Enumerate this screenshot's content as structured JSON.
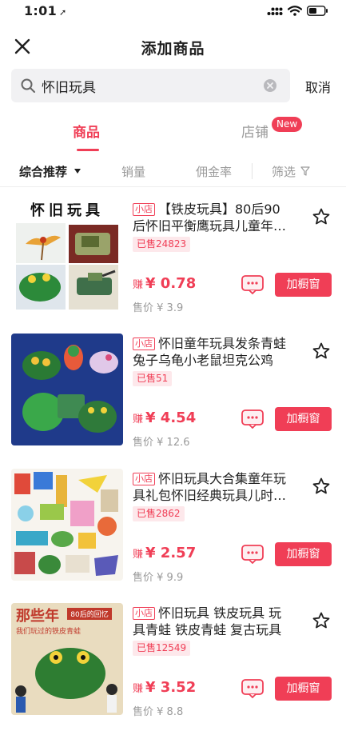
{
  "status": {
    "time": "1:01",
    "location_glyph": "➚"
  },
  "nav": {
    "title": "添加商品"
  },
  "search": {
    "query": "怀旧玩具",
    "cancel_label": "取消"
  },
  "tabs": {
    "goods": "商品",
    "shop": "店铺",
    "shop_badge": "New"
  },
  "filters": {
    "sort": "综合推荐",
    "sales": "销量",
    "commission": "佣金率",
    "screen": "筛选"
  },
  "common": {
    "store_tag": "小店",
    "earn_label": "赚",
    "price_label": "售价",
    "add_label": "加橱窗"
  },
  "products": [
    {
      "title": "【铁皮玩具】80后90后怀旧平衡鹰玩具儿童年…",
      "sold": "已售24823",
      "earn": "¥ 0.78",
      "price": "¥ 3.9",
      "thumb_caption": "怀旧玩具"
    },
    {
      "title": "怀旧童年玩具发条青蛙兔子乌龟小老鼠坦克公鸡",
      "sold": "已售51",
      "earn": "¥ 4.54",
      "price": "¥ 12.6"
    },
    {
      "title": "怀旧玩具大合集童年玩具礼包怀旧经典玩具儿时…",
      "sold": "已售2862",
      "earn": "¥ 2.57",
      "price": "¥ 9.9"
    },
    {
      "title": "怀旧玩具 铁皮玩具 玩具青蛙 铁皮青蛙 复古玩具",
      "sold": "已售12549",
      "earn": "¥ 3.52",
      "price": "¥ 8.8",
      "thumb_caption": "那些年",
      "thumb_sub": "我们玩过的铁皮青蛙",
      "thumb_tag": "80后的回忆"
    }
  ],
  "colors": {
    "accent": "#f03e56",
    "muted": "#9a9a9a",
    "search_bg": "#f1f1f3"
  }
}
